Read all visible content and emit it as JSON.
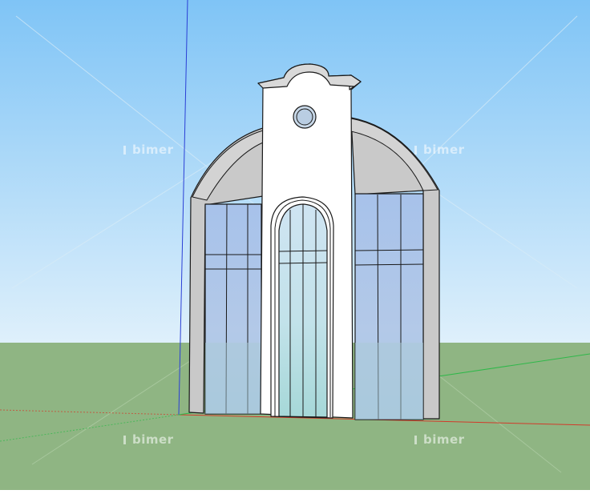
{
  "scene": {
    "sky_top_color": "#7fc4f6",
    "sky_bottom_color": "#dff0fb",
    "ground_color": "#8fb583",
    "axis_blue": "#2a3fd6",
    "axis_red": "#d23a2a",
    "axis_green": "#2fb84a"
  },
  "model": {
    "wall_color": "#c8c8c8",
    "front_color": "#ffffff",
    "glass_color": "#a9c5e6",
    "glass_lower_color": "#9dd0d6",
    "edge_color": "#1a1a1a"
  },
  "watermarks": [
    {
      "text": "bimer"
    },
    {
      "text": "bimer"
    },
    {
      "text": "bimer"
    },
    {
      "text": "bimer"
    }
  ]
}
